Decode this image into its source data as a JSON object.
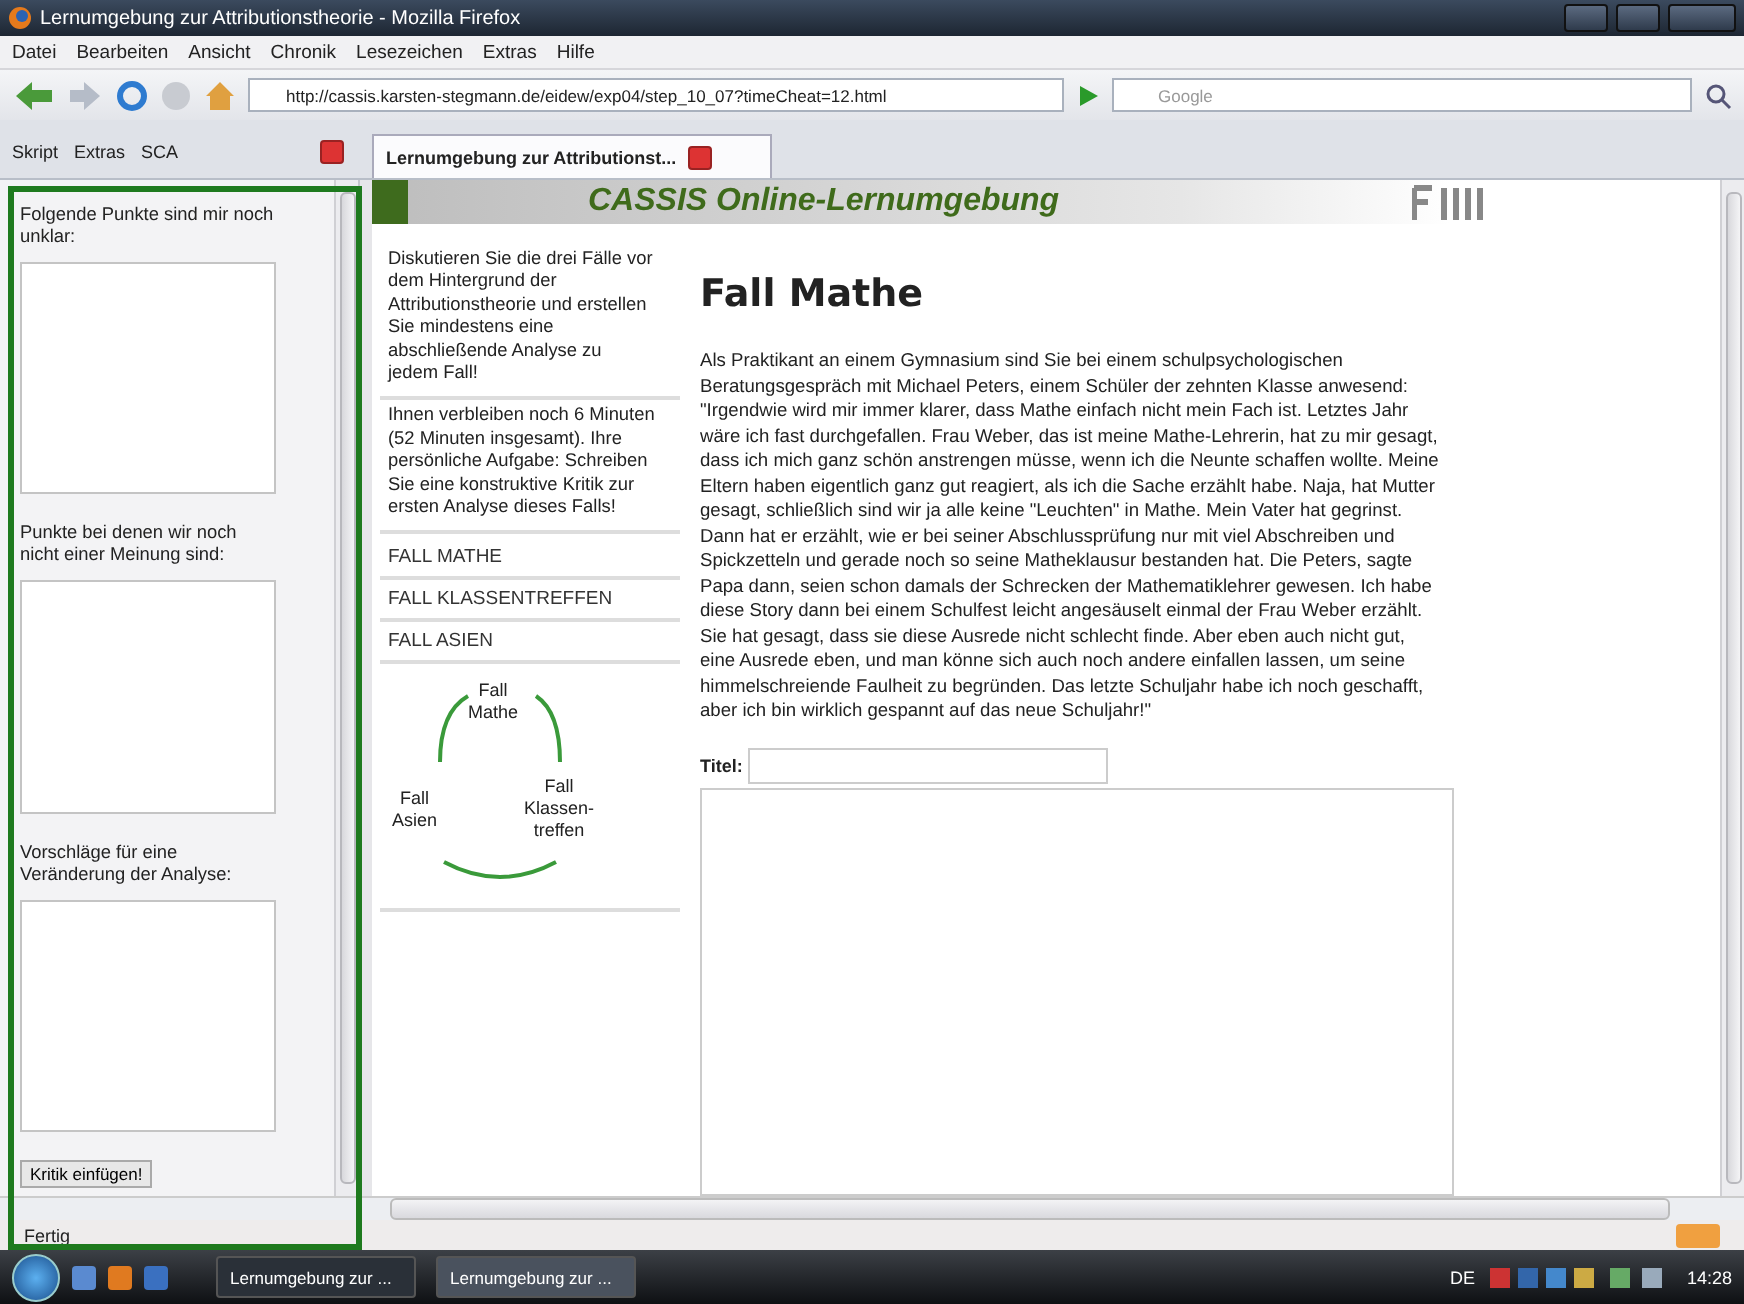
{
  "window": {
    "title": "Lernumgebung zur Attributionstheorie - Mozilla Firefox"
  },
  "menu": [
    "Datei",
    "Bearbeiten",
    "Ansicht",
    "Chronik",
    "Lesezeichen",
    "Extras",
    "Hilfe"
  ],
  "nav": {
    "url": "http://cassis.karsten-stegmann.de/eidew/exp04/step_10_07?timeCheat=12.html",
    "search_placeholder": "Google"
  },
  "sidebar_toolbar": [
    "Skript",
    "Extras",
    "SCA"
  ],
  "tabs": [
    {
      "label": "Lernumgebung zur Attributionst...",
      "selected": true
    }
  ],
  "sidebar": {
    "fields": [
      {
        "label": "Folgende Punkte sind mir noch unklar:"
      },
      {
        "label": "Punkte bei denen wir noch nicht einer Meinung sind:"
      },
      {
        "label": "Vorschläge für eine Veränderung der Analyse:"
      }
    ],
    "button": "Kritik einfügen!"
  },
  "page": {
    "banner": "CASSIS Online-Lernumgebung",
    "instructions": "Diskutieren Sie die drei Fälle vor dem Hintergrund der Attributionstheorie und erstellen Sie mindestens eine abschließende Analyse zu jedem Fall!",
    "remaining": "Ihnen verbleiben noch 6 Minuten (52 Minuten insgesamt). Ihre persönliche Aufgabe: Schreiben Sie eine konstruktive Kritik zur ersten Analyse dieses Falls!",
    "links": [
      "FALL MATHE",
      "FALL KLASSENTREFFEN",
      "FALL ASIEN"
    ],
    "diagram": [
      "Fall\nMathe",
      "Fall\nAsien",
      "Fall\nKlassen-\ntreffen"
    ],
    "heading": "Fall Mathe",
    "intro": "Als Praktikant an einem Gymnasium sind Sie bei einem schulpsychologischen Beratungsgespräch mit Michael Peters, einem Schüler der zehnten Klasse anwesend:",
    "quote": "\"Irgendwie wird mir immer klarer, dass Mathe einfach nicht mein Fach ist. Letztes Jahr wäre ich fast durchgefallen. Frau Weber, das ist meine Mathe-Lehrerin, hat zu mir gesagt, dass ich mich ganz schön anstrengen müsse, wenn ich die Neunte schaffen wollte. Meine Eltern haben eigentlich ganz gut reagiert, als ich die Sache erzählt habe. Naja, hat Mutter gesagt, schließlich sind wir ja alle keine \"Leuchten\" in Mathe. Mein Vater hat gegrinst. Dann hat er erzählt, wie er bei seiner Abschlussprüfung nur mit viel Abschreiben und Spickzetteln und gerade noch so seine Matheklausur bestanden hat. Die Peters, sagte Papa dann, seien schon damals der Schrecken der Mathematiklehrer gewesen. Ich habe diese Story dann bei einem Schulfest leicht angesäuselt einmal der Frau Weber erzählt. Sie hat gesagt, dass sie diese Ausrede nicht schlecht finde. Aber eben auch nicht gut, eine Ausrede eben, und man könne sich auch noch andere einfallen lassen, um seine himmelschreiende Faulheit zu begründen. Das letzte Schuljahr habe ich noch geschafft, aber ich bin wirklich gespannt auf das neue Schuljahr!\"",
    "title_label": "Titel:"
  },
  "status": "Fertig",
  "taskbar": {
    "tasks": [
      {
        "label": "Lernumgebung zur ...",
        "selected": false
      },
      {
        "label": "Lernumgebung zur ...",
        "selected": true
      }
    ],
    "language": "DE",
    "clock": "14:28"
  }
}
